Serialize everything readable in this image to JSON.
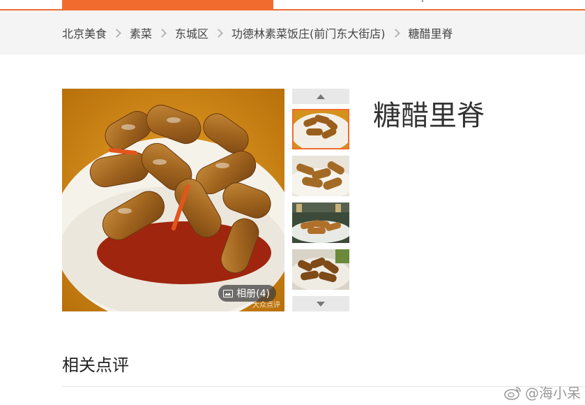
{
  "breadcrumb": {
    "items": [
      "北京美食",
      "素菜",
      "东城区",
      "功德林素菜饭庄(前门东大街店)",
      "糖醋里脊"
    ]
  },
  "dish": {
    "title": "糖醋里脊"
  },
  "gallery": {
    "album_label": "相册(4)",
    "watermark": "大众点评"
  },
  "sections": {
    "related_reviews": "相关点评"
  },
  "overlay": {
    "weibo_handle": "@海小呆"
  },
  "colors": {
    "accent": "#f26b2e",
    "crumb_bg": "#f4f4f4"
  }
}
